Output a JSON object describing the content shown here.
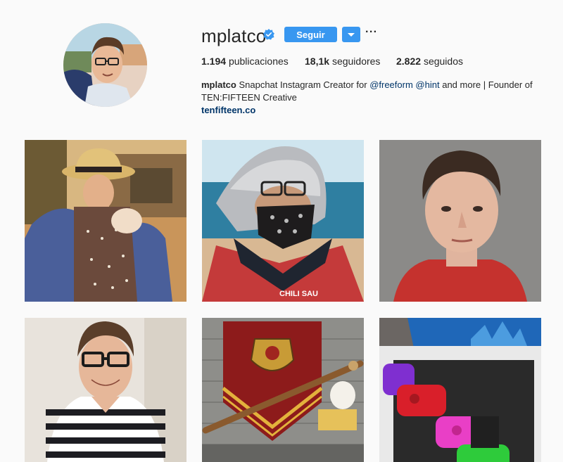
{
  "profile": {
    "username": "mplatco",
    "follow_label": "Seguir",
    "more_label": "···",
    "verified": true
  },
  "stats": {
    "posts_count": "1.194",
    "posts_label": "publicaciones",
    "followers_count": "18,1k",
    "followers_label": "seguidores",
    "following_count": "2.822",
    "following_label": "seguidos"
  },
  "bio": {
    "name": "mplatco",
    "text_before": "Snapchat Instagram Creator for",
    "mention1": "@freeform",
    "mention2": "@hint",
    "text_after": "and more | Founder of TEN:FIFTEEN Creative",
    "website": "tenfifteen.co"
  },
  "colors": {
    "accent": "#3897f0",
    "link": "#003569",
    "background": "#fafafa"
  },
  "posts": [
    {
      "subject": "man in straw hat carrying baby"
    },
    {
      "subject": "person in helmet and bandana"
    },
    {
      "subject": "young man portrait"
    },
    {
      "subject": "smiling man in striped shirt"
    },
    {
      "subject": "gryffindor banner and wand"
    },
    {
      "subject": "magicband box"
    }
  ]
}
